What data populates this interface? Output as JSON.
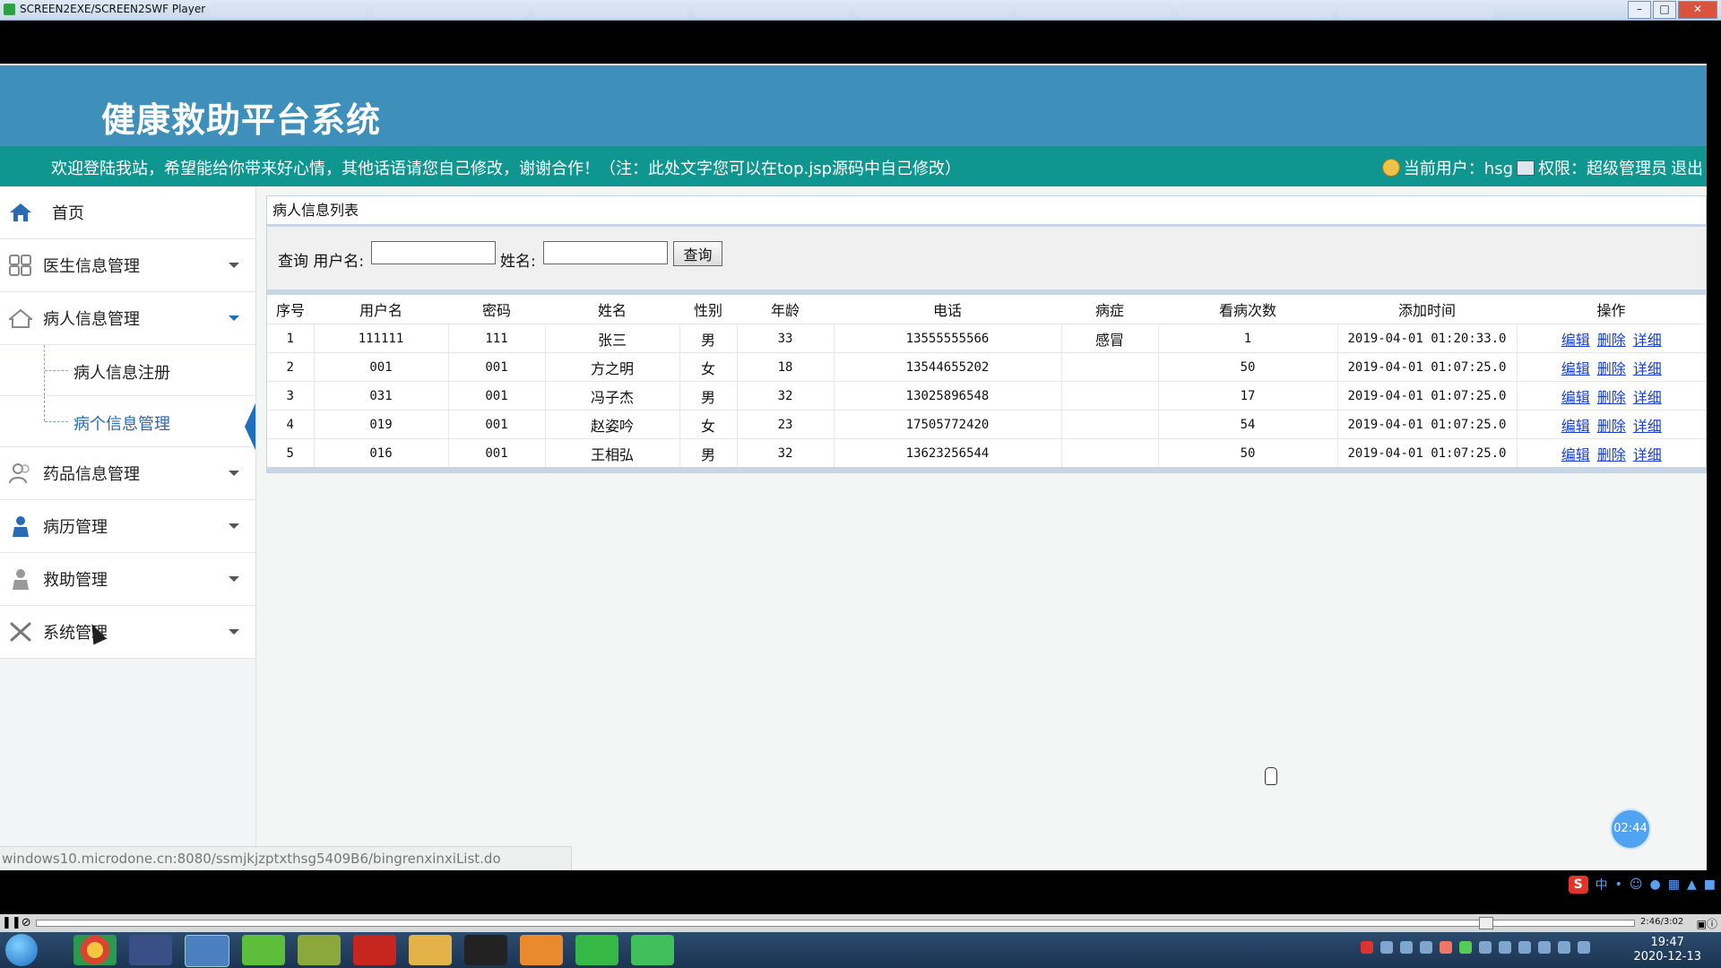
{
  "window": {
    "title": "SCREEN2EXE/SCREEN2SWF Player",
    "controls": {
      "minimize": "–",
      "maximize": "□",
      "close": "✕"
    }
  },
  "site": {
    "title": "健康救助平台系统",
    "welcome": "欢迎登陆我站，希望能给你带来好心情，其他话语请您自己修改，谢谢合作！（注：此处文字您可以在top.jsp源码中自己修改）",
    "current_user_label": "当前用户：hsg",
    "permission_label": "权限：超级管理员",
    "logout": "退出"
  },
  "sidebar": {
    "items": [
      {
        "label": "首页",
        "icon": "home-icon"
      },
      {
        "label": "医生信息管理",
        "icon": "grid-icon"
      },
      {
        "label": "病人信息管理",
        "icon": "house-icon",
        "open": true
      },
      {
        "label": "药品信息管理",
        "icon": "users-icon"
      },
      {
        "label": "病历管理",
        "icon": "person-icon"
      },
      {
        "label": "救助管理",
        "icon": "person-icon"
      },
      {
        "label": "系统管理",
        "icon": "tools-icon"
      }
    ],
    "subitems": [
      {
        "label": "病人信息注册"
      },
      {
        "label": "病个信息管理",
        "active": true
      }
    ]
  },
  "panel": {
    "title": "病人信息列表",
    "search": {
      "prefix": "查询",
      "username_label": "用户名:",
      "username_value": "",
      "name_label": "姓名:",
      "name_value": "",
      "button": "查询"
    },
    "table": {
      "headers": [
        "序号",
        "用户名",
        "密码",
        "姓名",
        "性别",
        "年龄",
        "电话",
        "病症",
        "看病次数",
        "添加时间",
        "操作"
      ],
      "actions": [
        "编辑",
        "删除",
        "详细"
      ],
      "rows": [
        {
          "no": "1",
          "username": "111111",
          "password": "111",
          "name": "张三",
          "gender": "男",
          "age": "33",
          "phone": "13555555566",
          "disease": "感冒",
          "visits": "1",
          "added": "2019-04-01 01:20:33.0"
        },
        {
          "no": "2",
          "username": "001",
          "password": "001",
          "name": "方之明",
          "gender": "女",
          "age": "18",
          "phone": "13544655202",
          "disease": "",
          "visits": "50",
          "added": "2019-04-01 01:07:25.0"
        },
        {
          "no": "3",
          "username": "031",
          "password": "001",
          "name": "冯子杰",
          "gender": "男",
          "age": "32",
          "phone": "13025896548",
          "disease": "",
          "visits": "17",
          "added": "2019-04-01 01:07:25.0"
        },
        {
          "no": "4",
          "username": "019",
          "password": "001",
          "name": "赵姿吟",
          "gender": "女",
          "age": "23",
          "phone": "17505772420",
          "disease": "",
          "visits": "54",
          "added": "2019-04-01 01:07:25.0"
        },
        {
          "no": "5",
          "username": "016",
          "password": "001",
          "name": "王相弘",
          "gender": "男",
          "age": "32",
          "phone": "13623256544",
          "disease": "",
          "visits": "50",
          "added": "2019-04-01 01:07:25.0"
        }
      ]
    }
  },
  "status_url": "windows10.microdone.cn:8080/ssmjkjzptxthsg5409B6/bingrenxinxiList.do",
  "timer": "02:44",
  "player": {
    "time": "2:46/3:02"
  },
  "taskbar": {
    "time": "19:47",
    "date": "2020-12-13"
  },
  "ime": {
    "logo": "S",
    "mode": "中"
  },
  "colors": {
    "header": "#3f8fbb",
    "infobar": "#0f9690",
    "link": "#1a3fd0",
    "accent": "#1f6fc0"
  }
}
